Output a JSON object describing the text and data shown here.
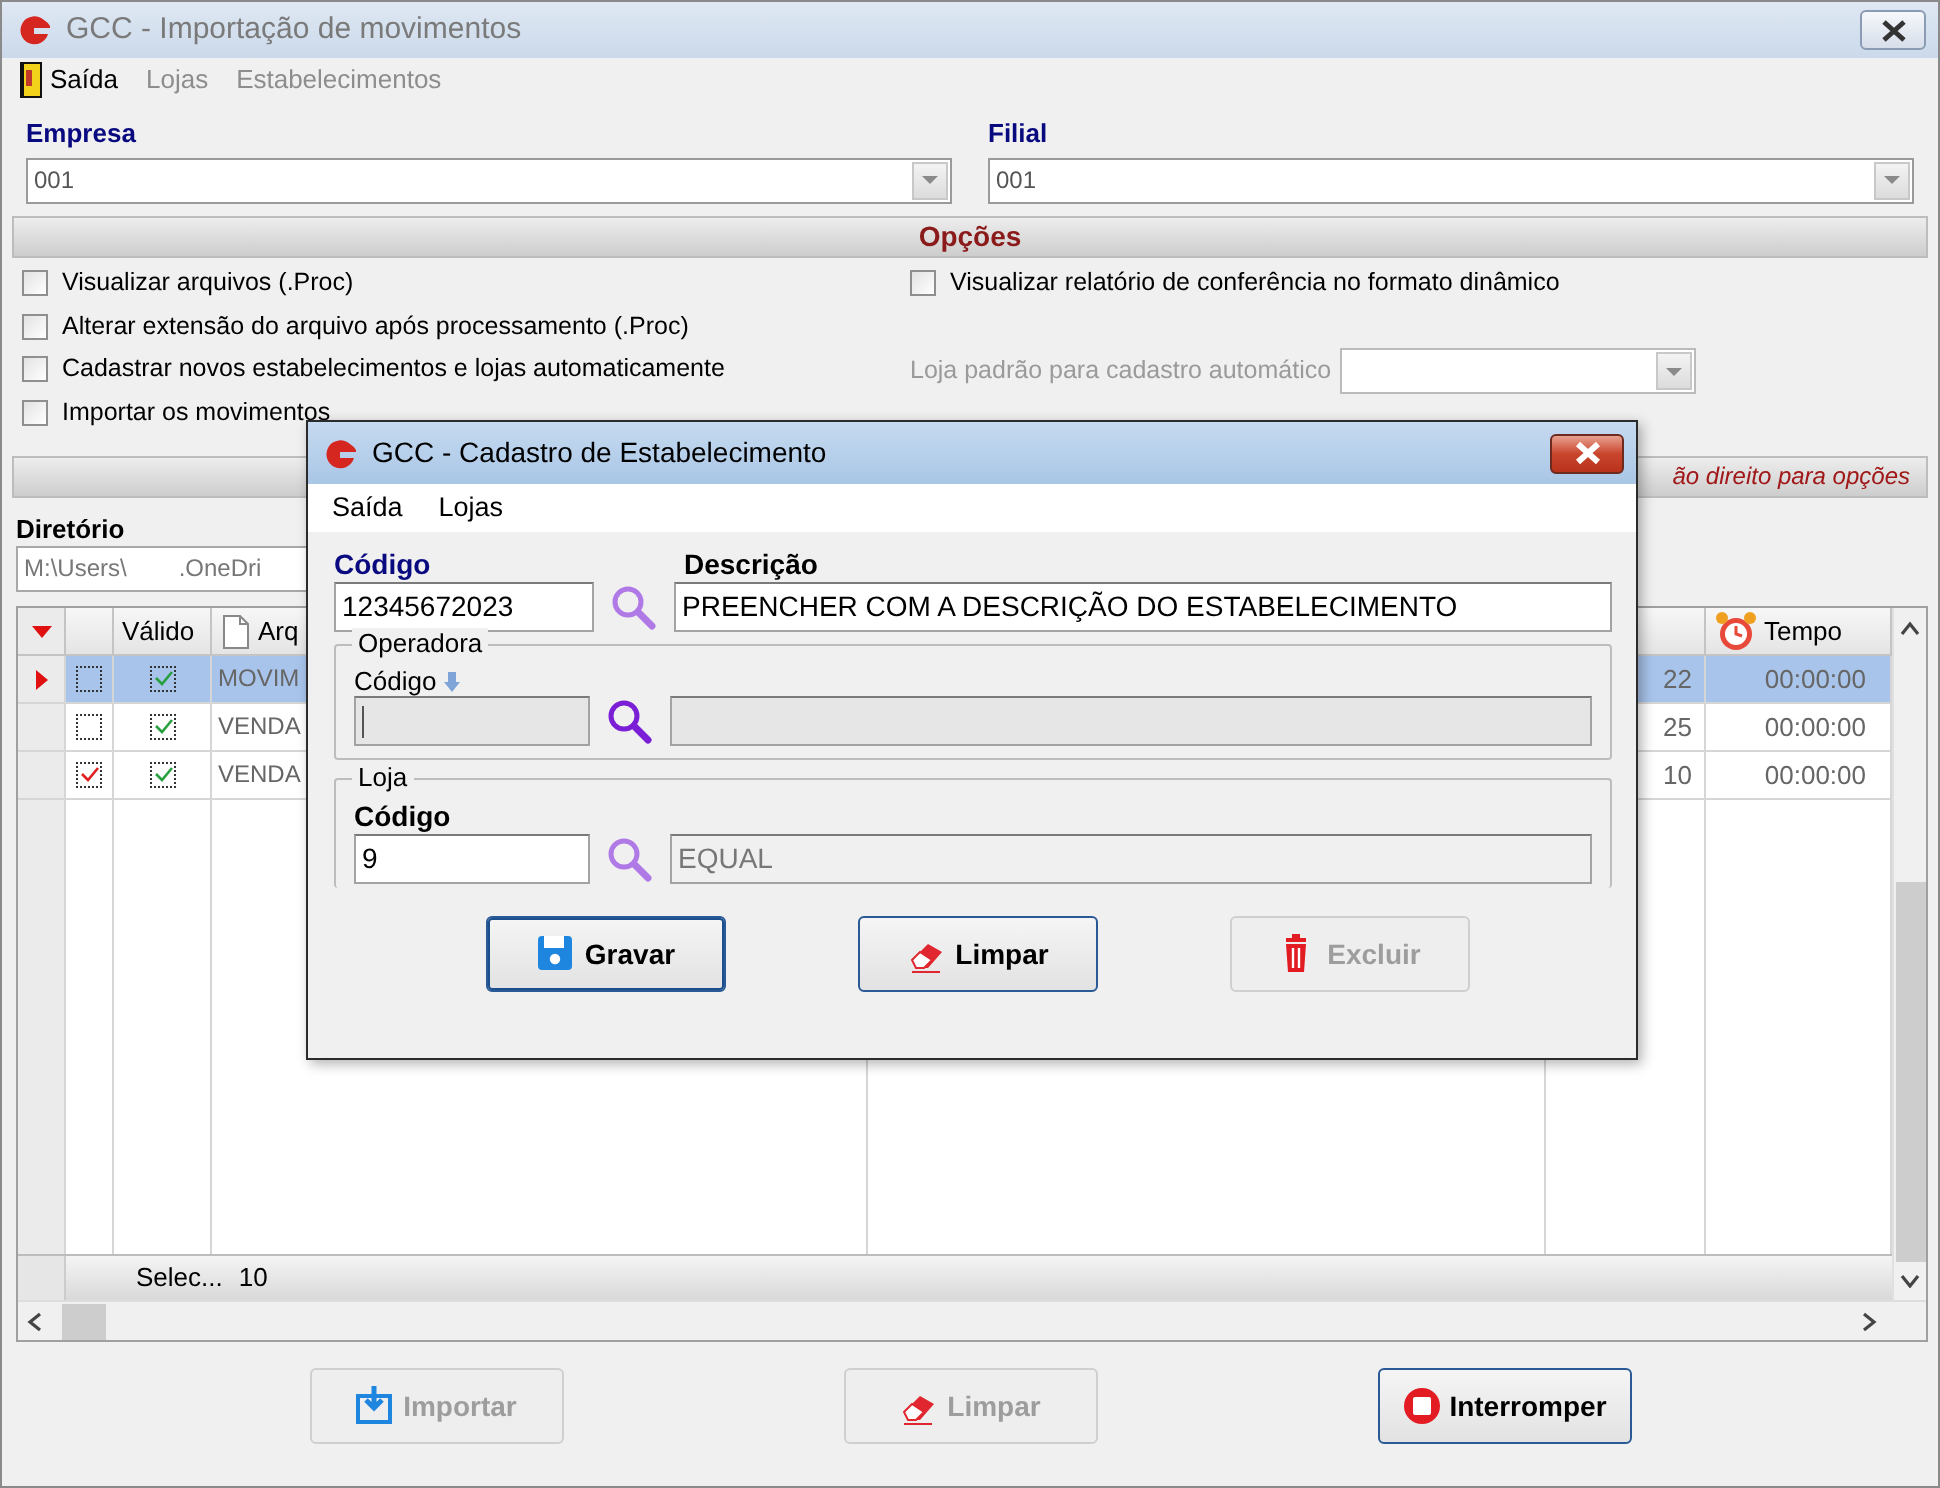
{
  "window": {
    "title": "GCC - Importação de movimentos",
    "active": false
  },
  "menu": [
    {
      "label": "Saída",
      "disabled": false
    },
    {
      "label": "Lojas",
      "disabled": true
    },
    {
      "label": "Estabelecimentos",
      "disabled": true
    }
  ],
  "empresa": {
    "label": "Empresa",
    "value": "001"
  },
  "filial": {
    "label": "Filial",
    "value": "001"
  },
  "options": {
    "title": "Opções",
    "left": [
      {
        "label": "Visualizar arquivos (.Proc)",
        "checked": false
      },
      {
        "label": "Alterar extensão do arquivo após processamento (.Proc)",
        "checked": false
      },
      {
        "label": "Cadastrar novos estabelecimentos e lojas automaticamente",
        "checked": false
      },
      {
        "label": "Importar os movimentos",
        "checked": false
      }
    ],
    "right": [
      {
        "label": "Visualizar relatório de conferência no formato dinâmico",
        "checked": false
      }
    ],
    "default_store": {
      "label": "Loja padrão para cadastro automático",
      "disabled": true
    }
  },
  "files": {
    "hint": "ão direito para opções",
    "directory_label": "Diretório",
    "directory_start": "M:\\Users\\",
    "directory_end": ".OneDri"
  },
  "grid": {
    "headers": {
      "valid": "Válido",
      "file": "Arq",
      "time": "Tempo"
    },
    "rows": [
      {
        "current": true,
        "checked": false,
        "valid": true,
        "file": "MOVIM",
        "count": "22",
        "time": "00:00:00"
      },
      {
        "current": false,
        "checked": false,
        "valid": true,
        "file": "VENDA",
        "count": "25",
        "time": "00:00:00"
      },
      {
        "current": false,
        "checked": true,
        "valid": true,
        "file": "VENDA",
        "count": "10",
        "time": "00:00:00"
      }
    ],
    "footer": {
      "label": "Selec...",
      "count": "10"
    }
  },
  "buttons": [
    {
      "kind": "import",
      "label": "Importar",
      "disabled": true
    },
    {
      "kind": "clear",
      "label": "Limpar",
      "disabled": true
    },
    {
      "kind": "stop",
      "label": "Interromper",
      "disabled": false
    }
  ],
  "dialog": {
    "title": "GCC - Cadastro de Estabelecimento",
    "active": true,
    "menu": [
      {
        "label": "Saída"
      },
      {
        "label": "Lojas"
      }
    ],
    "code": {
      "label": "Código",
      "value": "12345672023"
    },
    "description": {
      "label": "Descrição",
      "value": "PREENCHER COM A DESCRIÇÃO DO ESTABELECIMENTO"
    },
    "operadora": {
      "title": "Operadora",
      "code_label": "Código",
      "disabled": true
    },
    "loja": {
      "title": "Loja",
      "code_label": "Código",
      "code": "9",
      "name": "EQUAL"
    },
    "buttons": [
      {
        "kind": "save",
        "label": "Gravar",
        "disabled": false,
        "focused": true
      },
      {
        "kind": "clear",
        "label": "Limpar",
        "disabled": false,
        "focused": false
      },
      {
        "kind": "delete",
        "label": "Excluir",
        "disabled": true,
        "focused": false
      }
    ]
  }
}
